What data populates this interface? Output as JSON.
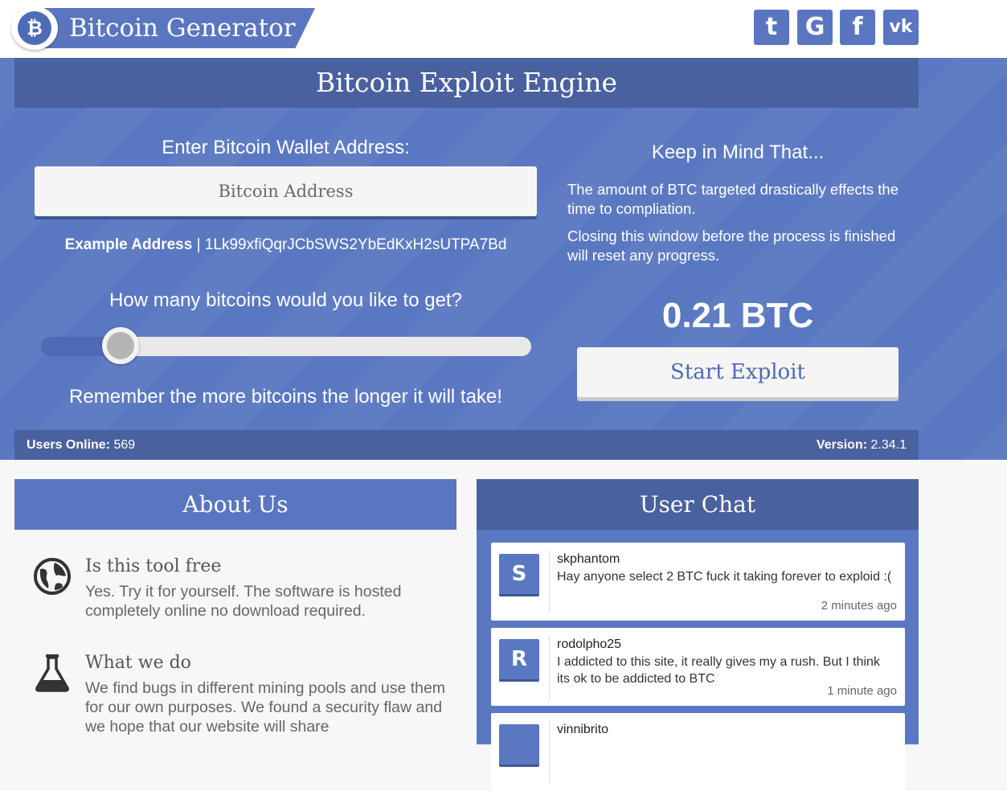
{
  "header": {
    "brand_title": "Bitcoin Generator",
    "logo_symbol": "₿",
    "social": [
      {
        "name": "tumblr",
        "glyph": "t"
      },
      {
        "name": "google",
        "glyph": "G"
      },
      {
        "name": "facebook",
        "glyph": "f"
      },
      {
        "name": "vk",
        "glyph": "vk"
      }
    ]
  },
  "hero": {
    "title": "Bitcoin Exploit Engine",
    "wallet_label": "Enter Bitcoin Wallet Address:",
    "wallet_placeholder": "Bitcoin Address",
    "example_label": "Example Address",
    "example_sep": " | ",
    "example_address": "1Lk99xfiQqrJCbSWS2YbEdKxH2sUTPA7Bd",
    "howmany_label": "How many bitcoins would you like to get?",
    "slider_fraction": 0.163,
    "remember_text": "Remember the more bitcoins the longer it will take!",
    "keep_title": "Keep in Mind That...",
    "keep_p1": "The amount of BTC targeted drastically effects the time to compliation.",
    "keep_p2": "Closing this window before the process is finished will reset any progress.",
    "btc_amount": "0.21 BTC",
    "start_button": "Start Exploit",
    "users_online_label": "Users Online:",
    "users_online_value": " 569",
    "version_label": "Version:",
    "version_value": " 2.34.1"
  },
  "about": {
    "title": "About Us",
    "items": [
      {
        "heading": "Is this tool free",
        "text": "Yes. Try it for yourself. The software is hosted completely online no download required.",
        "icon": "globe-icon"
      },
      {
        "heading": "What we do",
        "text": "We find bugs in different mining pools and use them for our own purposes. We found a security flaw and we hope that our website will share",
        "icon": "flask-icon"
      }
    ]
  },
  "chat": {
    "title": "User Chat",
    "messages": [
      {
        "avatar": "S",
        "user": "skphantom",
        "text": "Hay anyone select 2 BTC fuck it taking forever to exploid :(",
        "time": "2 minutes ago"
      },
      {
        "avatar": "R",
        "user": "rodolpho25",
        "text": "I addicted to this site, it really gives my a rush. But I think its ok to be addicted to BTC",
        "time": "1 minute ago"
      },
      {
        "avatar": "",
        "user": "vinnibrito",
        "text": "",
        "time": ""
      }
    ]
  },
  "colors": {
    "accent": "#5a76c0",
    "accent_dark": "#4a619f",
    "background": "#f7f7f7"
  }
}
